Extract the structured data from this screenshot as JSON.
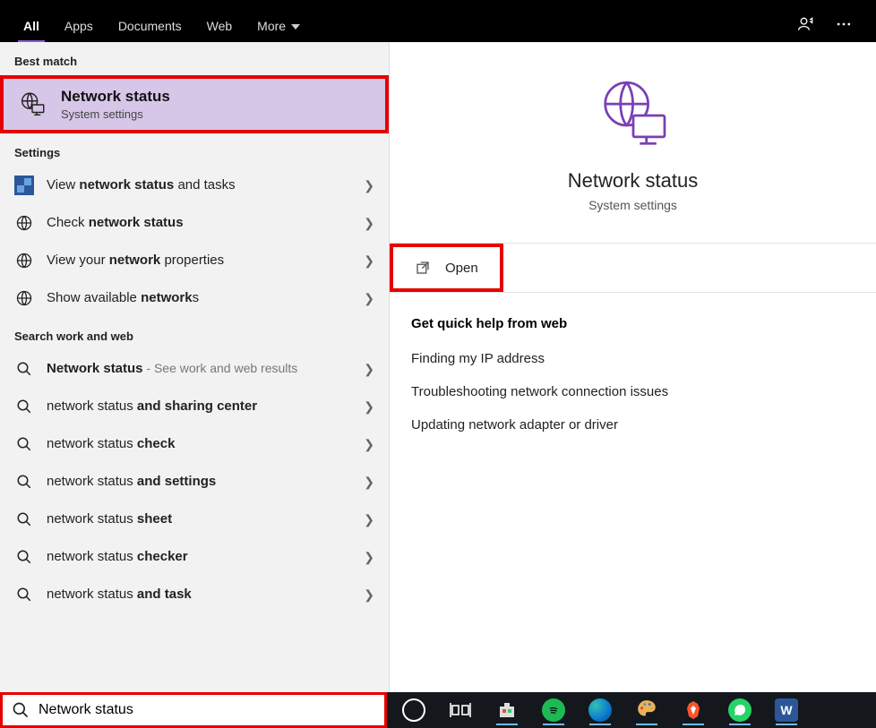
{
  "topbar": {
    "tabs": [
      "All",
      "Apps",
      "Documents",
      "Web",
      "More"
    ],
    "active_index": 0
  },
  "left": {
    "section_best": "Best match",
    "best_match": {
      "title": "Network status",
      "subtitle": "System settings"
    },
    "section_settings": "Settings",
    "settings_rows": [
      {
        "pre": "View ",
        "bold": "network status",
        "post": " and tasks"
      },
      {
        "pre": "Check ",
        "bold": "network status",
        "post": ""
      },
      {
        "pre": "View your ",
        "bold": "network",
        "post": " properties"
      },
      {
        "pre": "Show available ",
        "bold": "network",
        "post": "s"
      }
    ],
    "section_web": "Search work and web",
    "web_rows": [
      {
        "pre": "",
        "bold": "Network status",
        "post": "",
        "hint": " - See work and web results"
      },
      {
        "pre": "network status ",
        "bold": "and sharing center",
        "post": ""
      },
      {
        "pre": "network status ",
        "bold": "check",
        "post": ""
      },
      {
        "pre": "network status ",
        "bold": "and settings",
        "post": ""
      },
      {
        "pre": "network status ",
        "bold": "sheet",
        "post": ""
      },
      {
        "pre": "network status ",
        "bold": "checker",
        "post": ""
      },
      {
        "pre": "network status ",
        "bold": "and task",
        "post": ""
      }
    ]
  },
  "right": {
    "title": "Network status",
    "subtitle": "System settings",
    "open_label": "Open",
    "help_title": "Get quick help from web",
    "help_links": [
      "Finding my IP address",
      "Troubleshooting network connection issues",
      "Updating network adapter or driver"
    ]
  },
  "search": {
    "value": "Network status"
  }
}
